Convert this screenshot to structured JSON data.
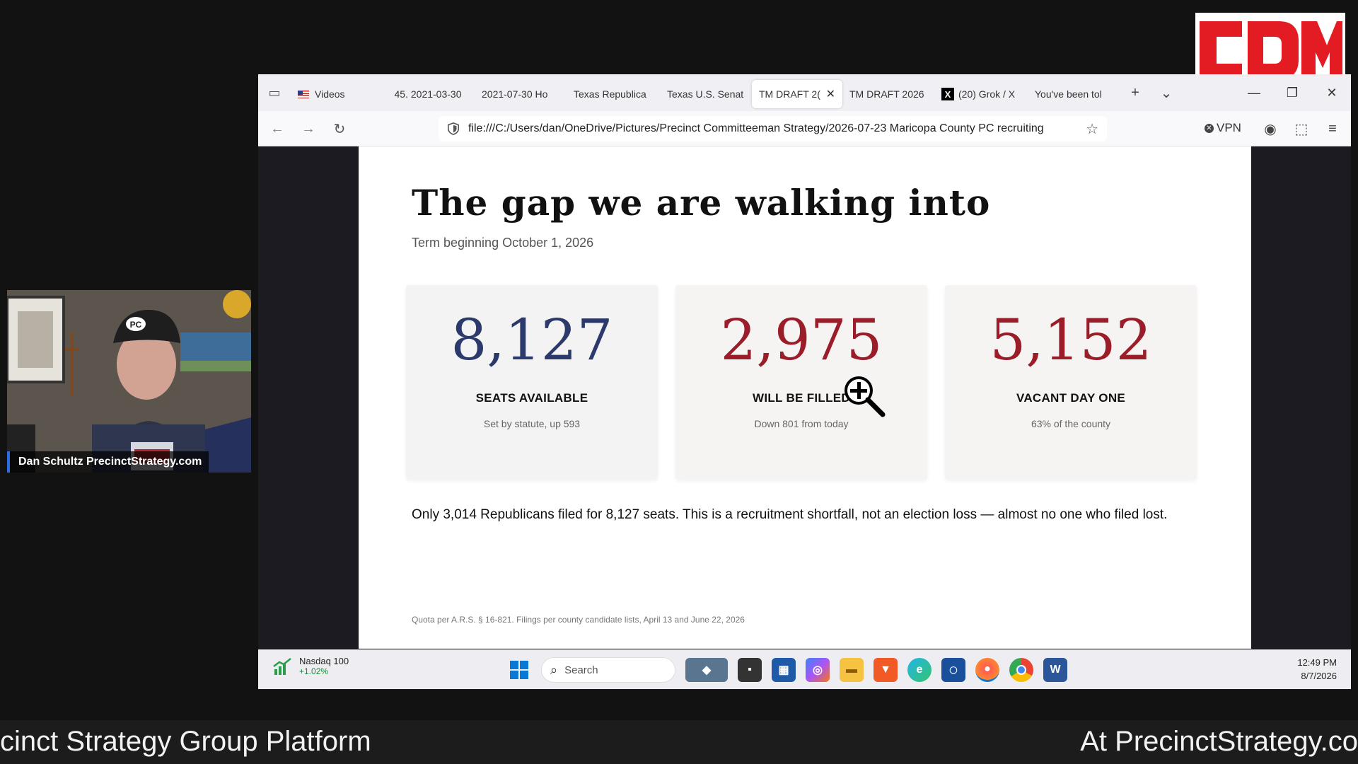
{
  "logo": {
    "text": "CDM",
    "color": "#e31b23"
  },
  "webcam": {
    "name": "Dan Schultz PrecinctStrategy.com",
    "cap_text": "PC"
  },
  "browser": {
    "tabs": [
      {
        "label": "Videos",
        "icon": "flag-icon"
      },
      {
        "label": "45. 2021-03-30"
      },
      {
        "label": "2021-07-30 Ho"
      },
      {
        "label": "Texas Republica"
      },
      {
        "label": "Texas U.S. Senat"
      },
      {
        "label": "TM DRAFT 2(",
        "active": true
      },
      {
        "label": "TM DRAFT 2026"
      },
      {
        "label": "(20) Grok / X",
        "icon": "x-logo-icon"
      },
      {
        "label": "You've been tol"
      }
    ],
    "url": "file:///C:/Users/dan/OneDrive/Pictures/Precinct Committeeman Strategy/2026-07-23 Maricopa County PC recruiting",
    "vpn_label": "VPN"
  },
  "page": {
    "title": "The gap we are walking into",
    "subtitle": "Term beginning October 1, 2026",
    "cards": [
      {
        "value": "8,127",
        "label": "SEATS AVAILABLE",
        "note": "Set by statute, up 593",
        "color": "#2b3a6b"
      },
      {
        "value": "2,975",
        "label": "WILL BE FILLED",
        "note": "Down 801 from today",
        "color": "#9b1d2a"
      },
      {
        "value": "5,152",
        "label": "VACANT DAY ONE",
        "note": "63% of the county",
        "color": "#9b1d2a"
      }
    ],
    "body": "Only 3,014 Republicans filed for 8,127 seats. This is a recruitment shortfall, not an election loss — almost no one who filed lost.",
    "footnote": "Quota per A.R.S. § 16-821. Filings per county candidate lists, April 13 and June 22, 2026"
  },
  "taskbar": {
    "stock_name": "Nasdaq 100",
    "stock_change": "+1.02%",
    "search_placeholder": "Search",
    "time": "12:49 PM",
    "date": "8/7/2026"
  },
  "banner": {
    "left": "cinct Strategy Group Platform",
    "right": "At PrecinctStrategy.co"
  }
}
